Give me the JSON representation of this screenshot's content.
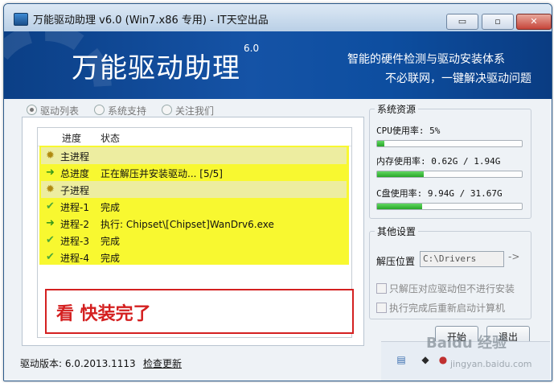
{
  "window": {
    "title": "万能驱动助理 v6.0  (Win7.x86 专用) - IT天空出品",
    "controls": {
      "minimize": "▭",
      "restore": "▫",
      "close": "✕"
    }
  },
  "banner": {
    "title": "万能驱动助理",
    "version": "6.0",
    "slogan_line1": "智能的硬件检测与驱动安装体系",
    "slogan_line2": "不必联网，一键解决驱动问题"
  },
  "tabs": [
    {
      "label": "驱动列表",
      "selected": true
    },
    {
      "label": "系统支持",
      "selected": false
    },
    {
      "label": "关注我们",
      "selected": false
    }
  ],
  "progress_list": {
    "columns": [
      "进度",
      "状态"
    ],
    "rows": [
      {
        "icon": "gear-icon",
        "name": "主进程",
        "status": ""
      },
      {
        "icon": "arrow-right-icon",
        "name": "总进度",
        "status": "正在解压并安装驱动... [5/5]"
      },
      {
        "icon": "gear-icon",
        "name": "子进程",
        "status": ""
      },
      {
        "icon": "check-icon",
        "name": "进程-1",
        "status": "完成"
      },
      {
        "icon": "arrow-right-icon",
        "name": "进程-2",
        "status": "执行: Chipset\\[Chipset]WanDrv6.exe"
      },
      {
        "icon": "check-icon",
        "name": "进程-3",
        "status": "完成"
      },
      {
        "icon": "check-icon",
        "name": "进程-4",
        "status": "完成"
      }
    ],
    "highlight_color": "#f8f830"
  },
  "annotation": {
    "text": "看 快装完了",
    "color": "#d42020"
  },
  "resources": {
    "title": "系统资源",
    "cpu": {
      "label": "CPU使用率:  5%",
      "fraction": 0.05
    },
    "memory": {
      "label": "内存使用率: 0.62G / 1.94G",
      "fraction": 0.32
    },
    "disk": {
      "label": "C盘使用率:  9.94G / 31.67G",
      "fraction": 0.31
    }
  },
  "settings": {
    "title": "其他设置",
    "extract_label": "解压位置",
    "extract_path": "C:\\Drivers",
    "browse": "->",
    "option1": "只解压对应驱动但不进行安装",
    "option2": "执行完成后重新启动计算机"
  },
  "buttons": {
    "start": "开始",
    "exit": "退出"
  },
  "status_bar": {
    "version": "驱动版本: 6.0.2013.1113",
    "update_link": "检查更新"
  },
  "watermark": {
    "brand": "Baidu 经验",
    "url": "jingyan.baidu.com"
  }
}
